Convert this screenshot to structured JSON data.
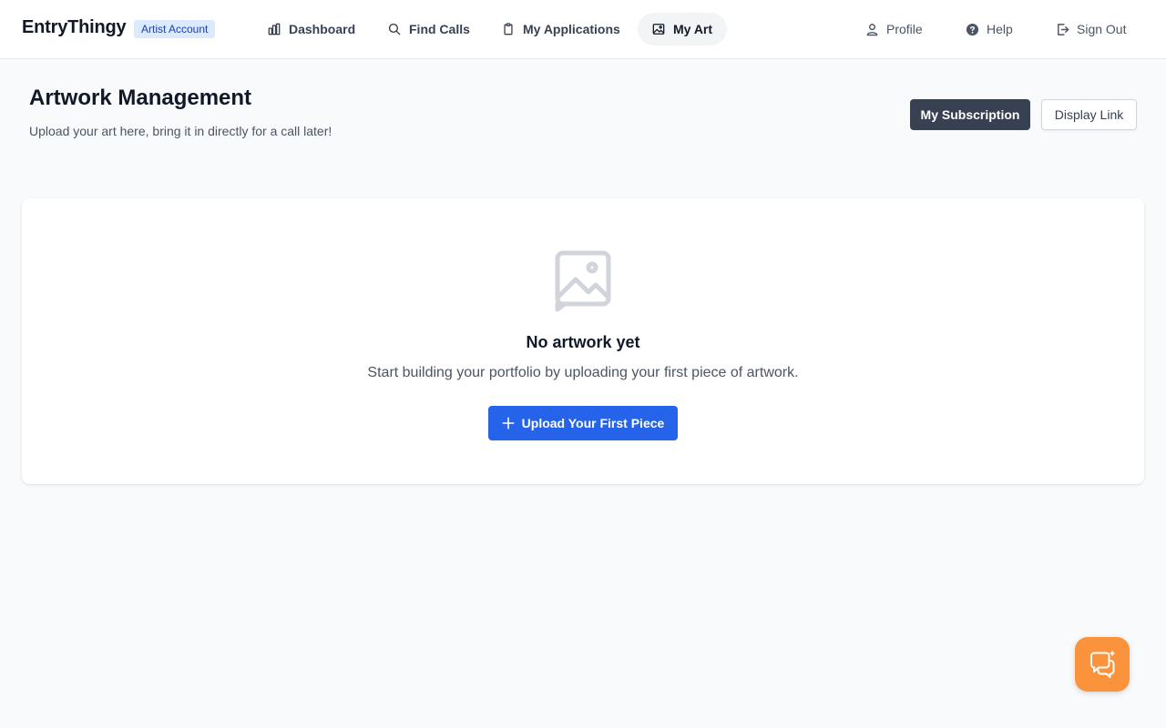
{
  "header": {
    "brand": "EntryThingy",
    "account_badge": "Artist Account",
    "nav": [
      {
        "label": "Dashboard",
        "icon": "bar-chart-icon"
      },
      {
        "label": "Find Calls",
        "icon": "search-icon"
      },
      {
        "label": "My Applications",
        "icon": "clipboard-icon"
      },
      {
        "label": "My Art",
        "icon": "image-icon",
        "active": true
      }
    ],
    "right": [
      {
        "label": "Profile",
        "icon": "user-icon"
      },
      {
        "label": "Help",
        "icon": "help-circle-icon"
      },
      {
        "label": "Sign Out",
        "icon": "sign-out-icon"
      }
    ]
  },
  "page": {
    "title": "Artwork Management",
    "subtitle": "Upload your art here, bring it in directly for a call later!",
    "subscription_button": "My Subscription",
    "display_link_button": "Display Link"
  },
  "empty_state": {
    "icon": "image-placeholder-icon",
    "title": "No artwork yet",
    "text": "Start building your portfolio by uploading your first piece of artwork.",
    "button": "Upload Your First Piece"
  },
  "chat": {
    "icon": "chat-sparkle-icon"
  },
  "colors": {
    "primary": "#2563eb",
    "dark_button": "#374151",
    "badge_bg": "#dbeafe",
    "badge_text": "#1e40af",
    "chat_fab": "#fb923c",
    "page_bg": "#f9fafb"
  }
}
